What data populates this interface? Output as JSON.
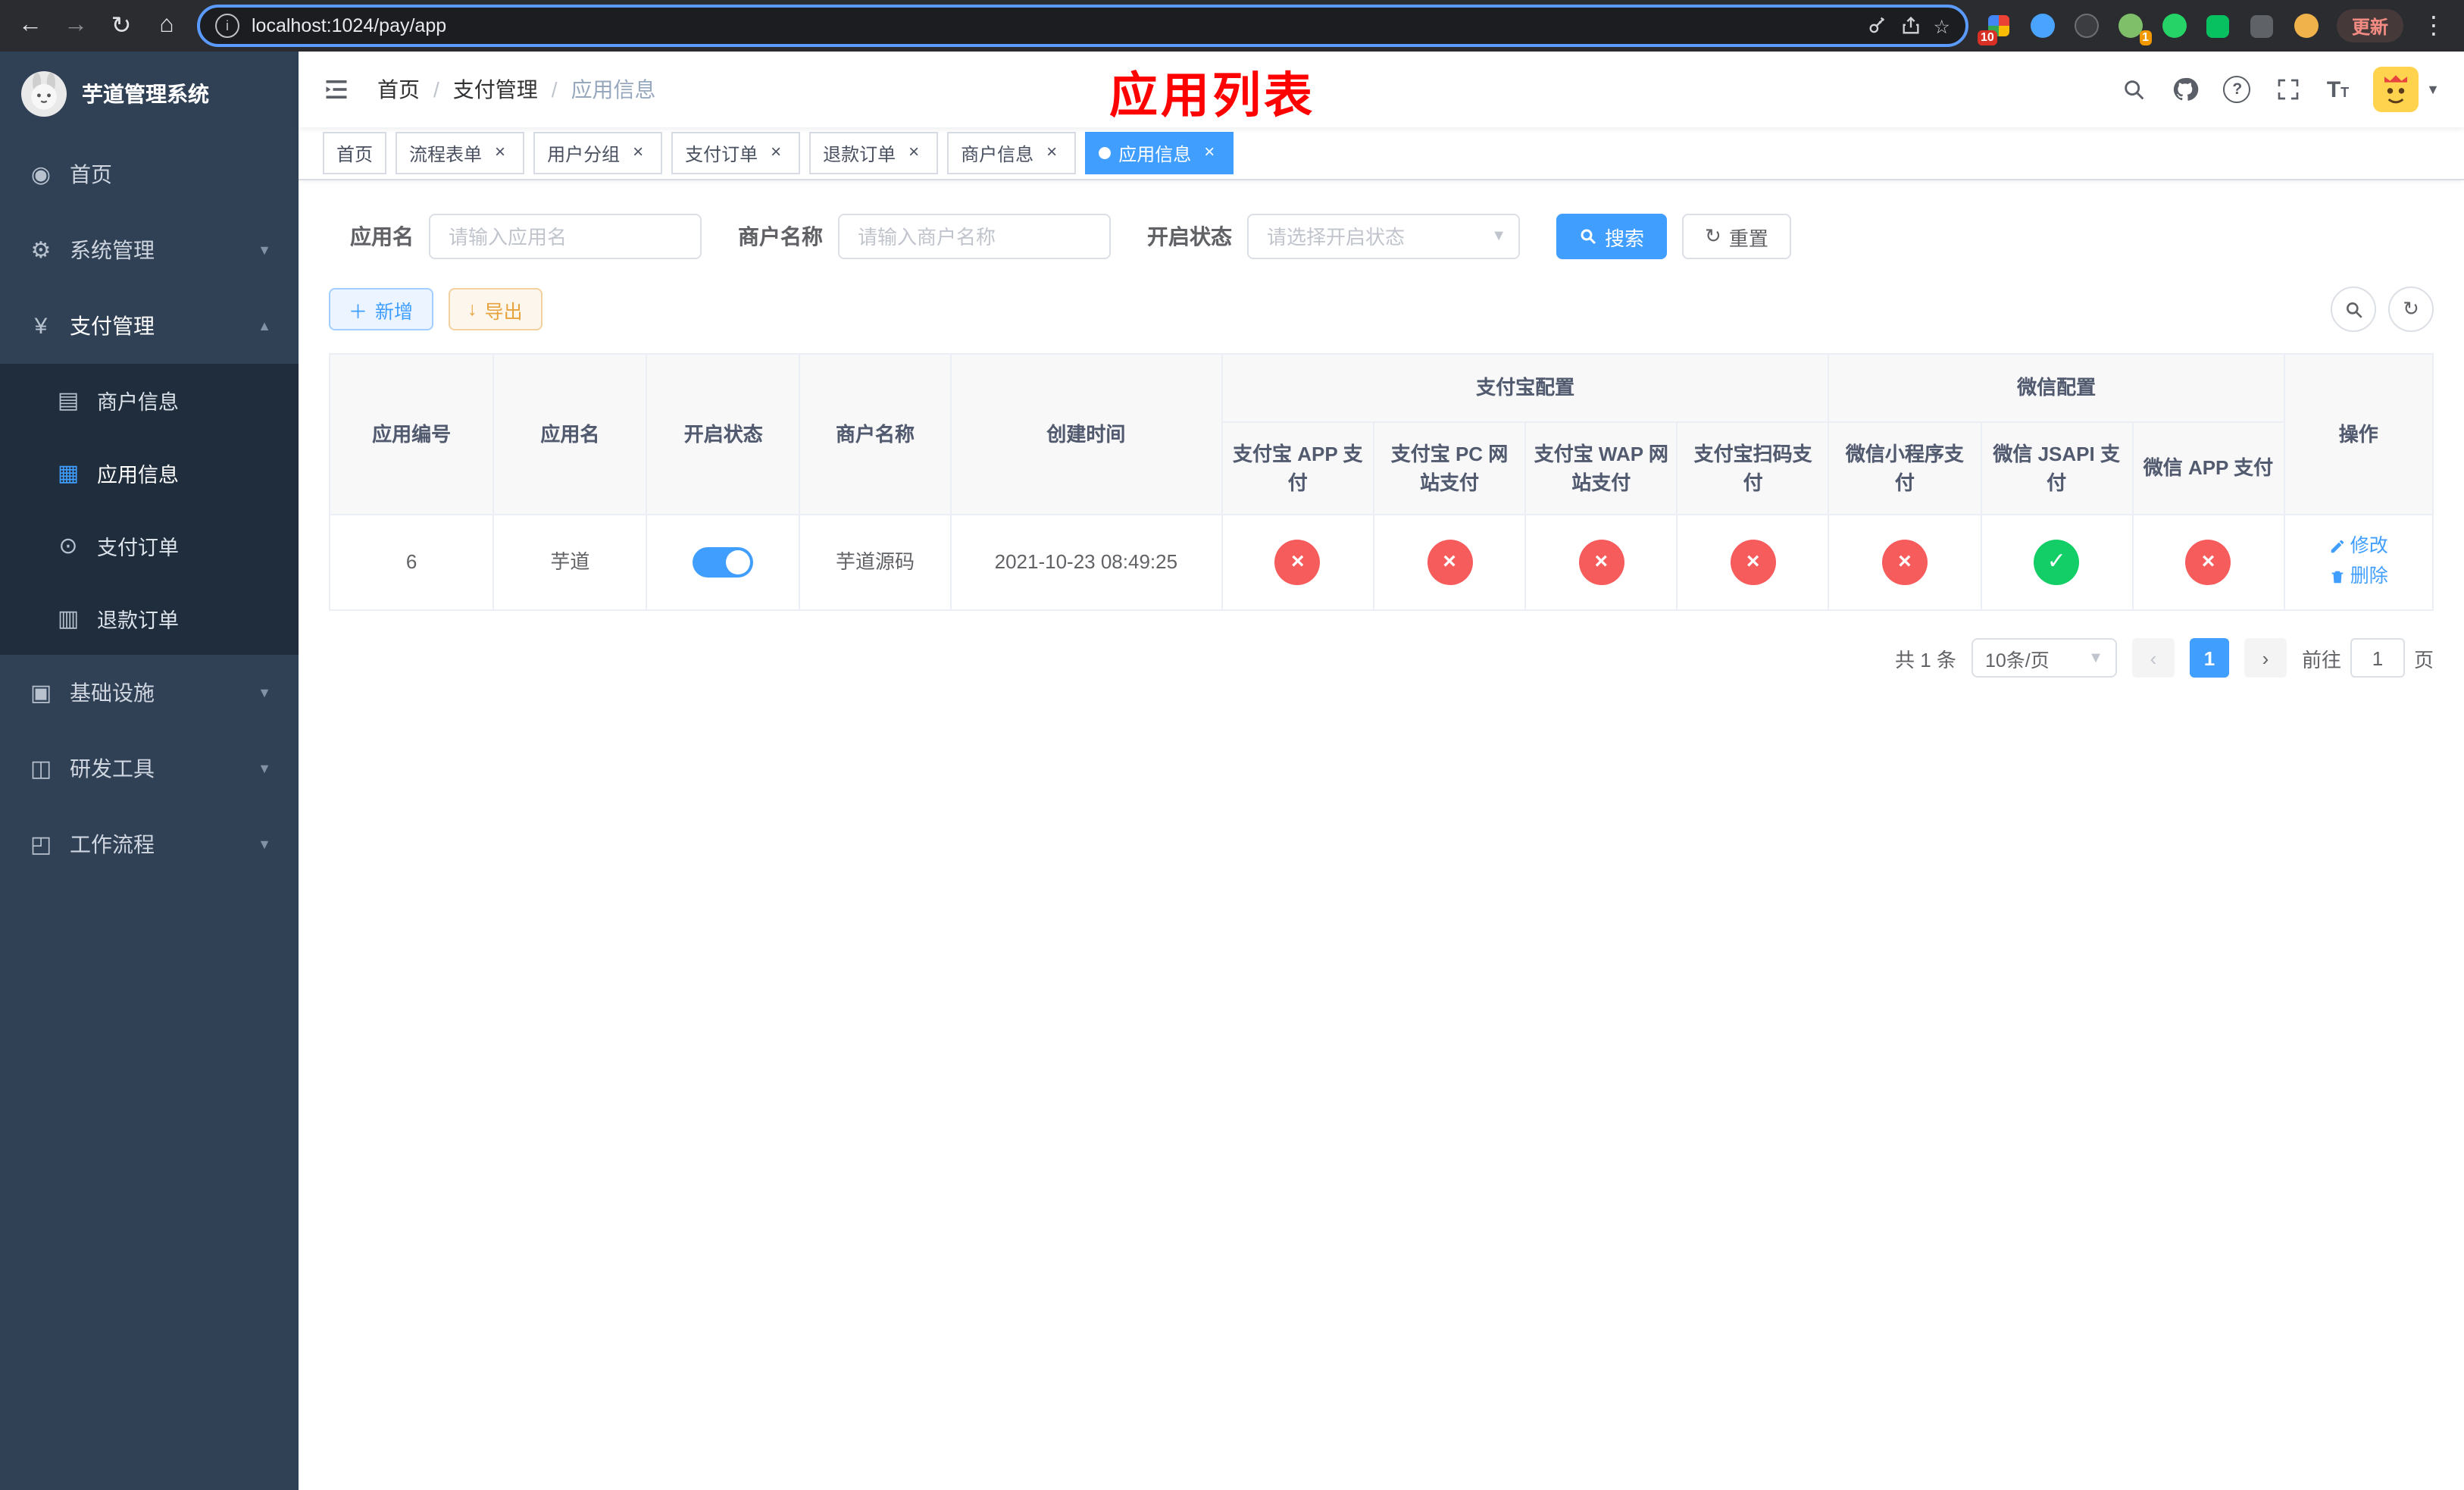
{
  "browser": {
    "url": "localhost:1024/pay/app",
    "update_label": "更新",
    "ext_badge_grid": "10",
    "ext_badge_avatar": "1"
  },
  "sidebar": {
    "title": "芋道管理系统",
    "items": [
      {
        "label": "首页"
      },
      {
        "label": "系统管理"
      },
      {
        "label": "支付管理"
      },
      {
        "label": "基础设施"
      },
      {
        "label": "研发工具"
      },
      {
        "label": "工作流程"
      }
    ],
    "submenu": [
      {
        "label": "商户信息"
      },
      {
        "label": "应用信息"
      },
      {
        "label": "支付订单"
      },
      {
        "label": "退款订单"
      }
    ]
  },
  "header": {
    "breadcrumb": [
      {
        "label": "首页"
      },
      {
        "label": "支付管理"
      },
      {
        "label": "应用信息"
      }
    ],
    "overlay_title": "应用列表"
  },
  "tabs": [
    {
      "label": "首页"
    },
    {
      "label": "流程表单"
    },
    {
      "label": "用户分组"
    },
    {
      "label": "支付订单"
    },
    {
      "label": "退款订单"
    },
    {
      "label": "商户信息"
    },
    {
      "label": "应用信息"
    }
  ],
  "filters": {
    "app_name_label": "应用名",
    "app_name_placeholder": "请输入应用名",
    "merchant_label": "商户名称",
    "merchant_placeholder": "请输入商户名称",
    "status_label": "开启状态",
    "status_placeholder": "请选择开启状态",
    "search_label": "搜索",
    "reset_label": "重置"
  },
  "toolbar": {
    "add_label": "新增",
    "export_label": "导出"
  },
  "table": {
    "col_id": "应用编号",
    "col_name": "应用名",
    "col_status": "开启状态",
    "col_merchant": "商户名称",
    "col_created": "创建时间",
    "alipay_group": "支付宝配置",
    "wechat_group": "微信配置",
    "col_op": "操作",
    "sub_cols": [
      "支付宝 APP 支付",
      "支付宝 PC 网站支付",
      "支付宝 WAP 网站支付",
      "支付宝扫码支付",
      "微信小程序支付",
      "微信 JSAPI 支付",
      "微信 APP 支付"
    ],
    "rows": [
      {
        "id": "6",
        "name": "芋道",
        "enabled": "on",
        "merchant": "芋道源码",
        "created": "2021-10-23 08:49:25",
        "statuses": [
          "error",
          "error",
          "error",
          "error",
          "error",
          "success",
          "error"
        ],
        "edit_label": "修改",
        "delete_label": "删除"
      }
    ]
  },
  "pagination": {
    "total": "共 1 条",
    "page_size": "10条/页",
    "page": "1",
    "goto_label": "前往",
    "goto_value": "1",
    "page_unit": "页"
  },
  "colors": {
    "primary": "#409eff",
    "danger": "#f75c5c",
    "success": "#13ce66",
    "sidebar_bg": "#304156",
    "submenu_bg": "#1f2d3d",
    "overlay_title": "#fe0202"
  }
}
